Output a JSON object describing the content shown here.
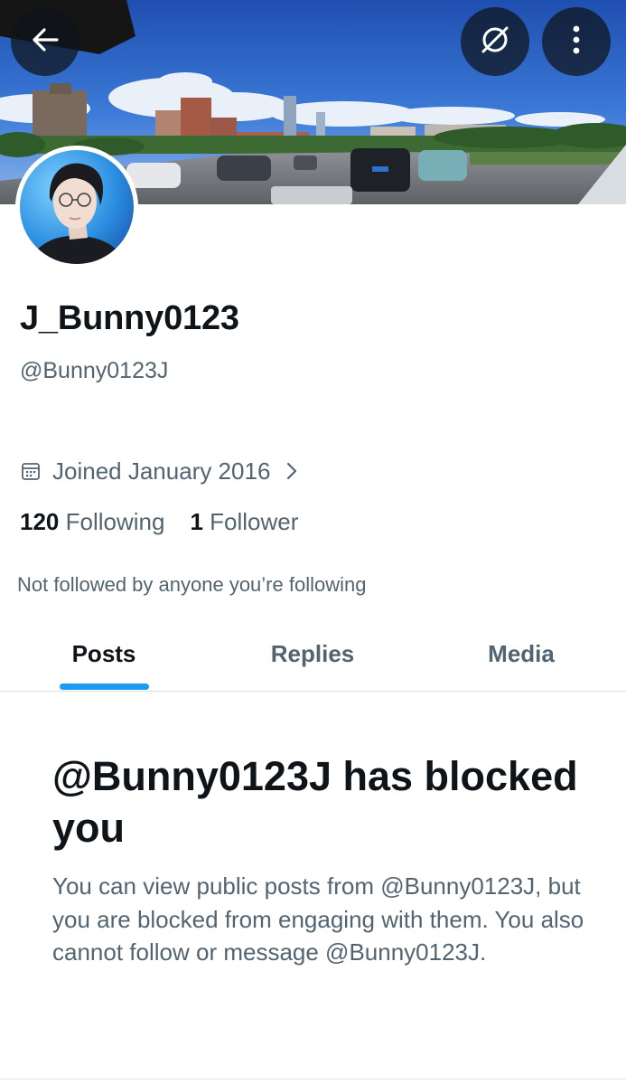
{
  "header": {
    "back_icon": "arrow-left-icon",
    "grok_icon": "grok-slash-circle-icon",
    "more_icon": "more-vertical-icon",
    "banner_image": "city-street-blue-sky-photo",
    "avatar_image": "profile-photo"
  },
  "profile": {
    "display_name": "J_Bunny0123",
    "handle": "@Bunny0123J",
    "joined_icon": "calendar-icon",
    "joined_text": "Joined January 2016",
    "joined_chevron_icon": "chevron-right-icon",
    "following_count": "120",
    "following_label": "Following",
    "followers_count": "1",
    "followers_label": "Follower",
    "not_followed_text": "Not followed by anyone you’re following"
  },
  "tabs": [
    {
      "label": "Posts",
      "selected": true
    },
    {
      "label": "Replies",
      "selected": false
    },
    {
      "label": "Media",
      "selected": false
    }
  ],
  "blocked": {
    "title": "@Bunny0123J has blocked you",
    "description": "You can view public posts from @Bunny0123J, but you are blocked from engaging with them. You also cannot follow or message @Bunny0123J."
  },
  "colors": {
    "accent": "#1d9bf0",
    "text_primary": "#0f1419",
    "text_secondary": "#536471",
    "button_overlay": "#0f1419"
  }
}
